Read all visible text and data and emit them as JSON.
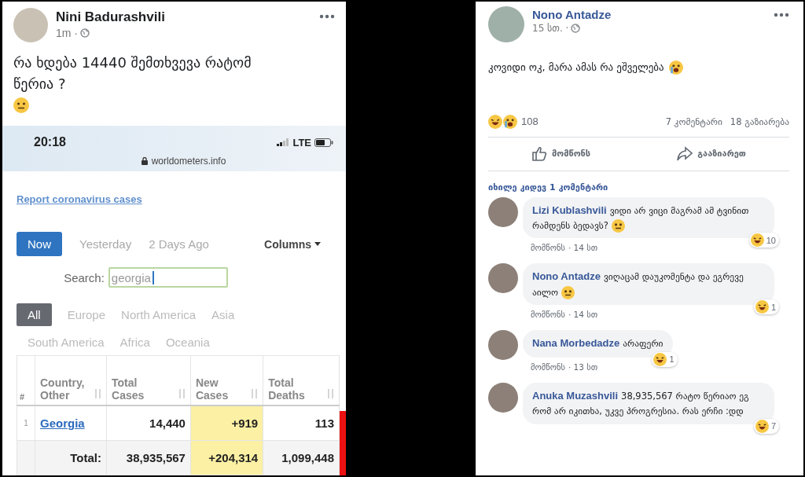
{
  "left_post": {
    "author": "Nini Badurashvili",
    "time": "1m ·",
    "text": "რა ხდება 14440 შემთხვევა რატომ წერია ?",
    "screenshot": {
      "clock": "20:18",
      "network": "LTE",
      "url": "worldometers.info",
      "report_link": "Report coronavirus cases",
      "time_tabs": [
        {
          "label": "Now",
          "selected": true
        },
        {
          "label": "Yesterday",
          "selected": false
        },
        {
          "label": "2 Days Ago",
          "selected": false
        }
      ],
      "columns_menu": "Columns",
      "search_label": "Search:",
      "search_value": "georgia",
      "region_tabs": [
        {
          "label": "All",
          "selected": true
        },
        {
          "label": "Europe",
          "selected": false
        },
        {
          "label": "North America",
          "selected": false
        },
        {
          "label": "Asia",
          "selected": false
        },
        {
          "label": "South America",
          "selected": false
        },
        {
          "label": "Africa",
          "selected": false
        },
        {
          "label": "Oceania",
          "selected": false
        }
      ],
      "table": {
        "columns": [
          "#",
          "Country, Other",
          "Total Cases",
          "New Cases",
          "Total Deaths"
        ],
        "rows": [
          {
            "cells": [
              "1",
              "Georgia",
              "14,440",
              "+919",
              "113"
            ]
          },
          {
            "cells": [
              "",
              "Total:",
              "38,935,567",
              "+204,314",
              "1,099,448"
            ]
          }
        ]
      }
    }
  },
  "right_post": {
    "author": "Nono Antadze",
    "time": "15 სთ. ·",
    "text": "კოვიდი ოკ, მარა ამას რა ეშველება",
    "reaction_count": "108",
    "comments_count": "7 კომენტარი",
    "shares_count": "18 გაზიარება",
    "actions": [
      "მომწონს",
      "გააზიარეთ"
    ],
    "more_comments": "იხილე კიდევ 1 კომენტარი",
    "comments": [
      {
        "author": "Lizi Kublashvili",
        "text": "ვიდი არ ვიცი მაგრამ ამ ტვინით რამდენს ბედავს?",
        "has_emoji": true,
        "like": "მომწონს",
        "time": "· 14 სთ",
        "reactions": "10"
      },
      {
        "author": "Nono Antadze",
        "text": "ვიღაცამ დაუკომენტა და ეგრევე აილო",
        "has_emoji": true,
        "like": "მომწონს",
        "time": "· 14 სთ",
        "reactions": "1"
      },
      {
        "author": "Nana Morbedadze",
        "text": "არაფერი",
        "has_emoji": false,
        "like": "მომწონს",
        "time": "· 13 სთ",
        "reactions": "1"
      },
      {
        "author": "Anuka Muzashvili",
        "text": "38,935,567 რატო წერიაო ეგ რომ არ იკითხა, უკვე პროგრესია. რას ერჩი :დდ",
        "has_emoji": false,
        "reactions": "7"
      }
    ]
  }
}
